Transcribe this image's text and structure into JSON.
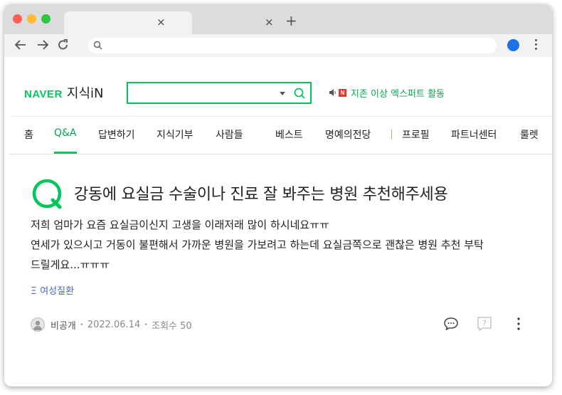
{
  "browser": {
    "tabs": [
      {
        "label": "",
        "close_icon": "×"
      },
      {
        "label": "",
        "close_icon": "×"
      }
    ],
    "new_tab_icon": "+",
    "address_bar": {
      "value": "",
      "placeholder": ""
    },
    "window_controls": {
      "close_color": "#ff5f57",
      "minimize_color": "#febc2e",
      "maximize_color": "#28c840"
    }
  },
  "header": {
    "logo_brand": "NAVER",
    "logo_service": "지식iN",
    "search": {
      "value": "",
      "placeholder": ""
    },
    "expert_badge": "N",
    "expert_text": "지존 이상 엑스퍼트 활동"
  },
  "nav": {
    "items": [
      {
        "label": "홈",
        "active": false
      },
      {
        "label": "Q&A",
        "active": true
      },
      {
        "label": "답변하기",
        "active": false
      },
      {
        "label": "지식기부",
        "active": false
      },
      {
        "label": "사람들",
        "active": false
      },
      {
        "label": "베스트",
        "active": false
      },
      {
        "label": "명예의전당",
        "active": false
      },
      {
        "label": "프로필",
        "active": false
      },
      {
        "label": "파트너센터",
        "active": false
      },
      {
        "label": "룰렛",
        "active": false
      }
    ]
  },
  "question": {
    "title": "강동에 요실금 수술이나 진료 잘 봐주는 병원 추천해주세용",
    "body_lines": [
      "저희 엄마가 요즘 요실금이신지 고생을 이래저래 많이 하시네요ㅠㅠ",
      "연세가 있으시고 거동이 불편해서 가까운 병원을 가보려고 하는데 요실금쪽으로 괜찮은 병원 추천 부탁",
      "드릴게요...ㅠㅠㅠ"
    ],
    "category": "여성질환",
    "author": "비공개",
    "date": "2022.06.14",
    "views": "조회수 50"
  },
  "colors": {
    "accent": "#03c75a",
    "accent_text": "#03a94e",
    "link": "#4a68c9"
  }
}
